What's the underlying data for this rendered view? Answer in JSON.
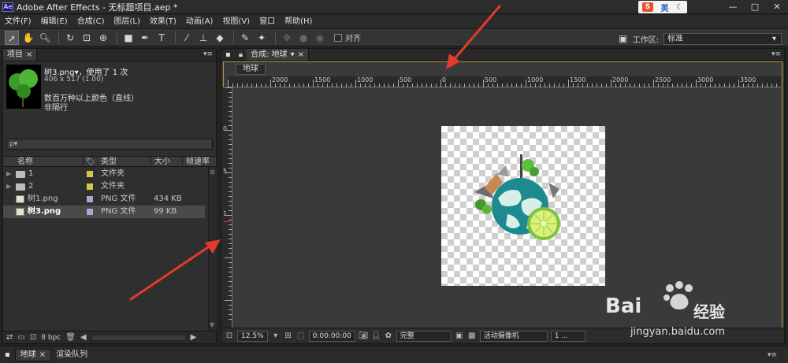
{
  "window": {
    "logo": "Ae",
    "title": "Adobe After Effects - 无标题项目.aep *",
    "controls": [
      "—",
      "□",
      "✕"
    ]
  },
  "ime": {
    "badge": "S",
    "lang": "英",
    "mode_icon": "moon-icon"
  },
  "menu": [
    "文件(F)",
    "编辑(E)",
    "合成(C)",
    "图层(L)",
    "效果(T)",
    "动画(A)",
    "视图(V)",
    "窗口",
    "帮助(H)"
  ],
  "toolbar": {
    "snap_label": "对齐",
    "workspace_label": "工作区:",
    "workspace_value": "标准"
  },
  "project": {
    "tab_label": "项目",
    "asset_name": "树3.png▾，使用了 1 次",
    "asset_dims": "406 x 517 (1.00)",
    "asset_colors": "数百万种以上颜色（直线）",
    "asset_interlace": "非隔行",
    "search_placeholder": "ρ▾",
    "columns": {
      "name": "名称",
      "type": "类型",
      "size": "大小",
      "fps": "帧速率"
    },
    "rows": [
      {
        "name": "1",
        "type": "文件夹",
        "size": "",
        "kind": "folder",
        "label_color": "#d8c64a"
      },
      {
        "name": "2",
        "type": "文件夹",
        "size": "",
        "kind": "folder",
        "label_color": "#d8c64a"
      },
      {
        "name": "树1.png",
        "type": "PNG 文件",
        "size": "434 KB",
        "kind": "png",
        "label_color": "#a9a9d0"
      },
      {
        "name": "树3.png",
        "type": "PNG 文件",
        "size": "99 KB",
        "kind": "png",
        "label_color": "#a9a9d0"
      }
    ],
    "bpc": "8 bpc"
  },
  "comp": {
    "tab_label": "合成: 地球",
    "flowchart_chip": "地球",
    "ruler_labels": [
      "2000",
      "1500",
      "1000",
      "500",
      "0",
      "500",
      "1000",
      "1500",
      "2000",
      "2500",
      "3000",
      "3500"
    ],
    "vruler_labels": [
      "0",
      "5",
      "1"
    ],
    "zoom": "12.5%",
    "timecode": "0:00:00:00",
    "resolution": "完整",
    "camera": "活动摄像机",
    "views": "1 ..."
  },
  "timeline": {
    "tabs": [
      "地球",
      "渲染队列"
    ]
  },
  "watermark": {
    "text": "jingyan.baidu.com",
    "brand": "Bai",
    "brand2": "经验"
  }
}
